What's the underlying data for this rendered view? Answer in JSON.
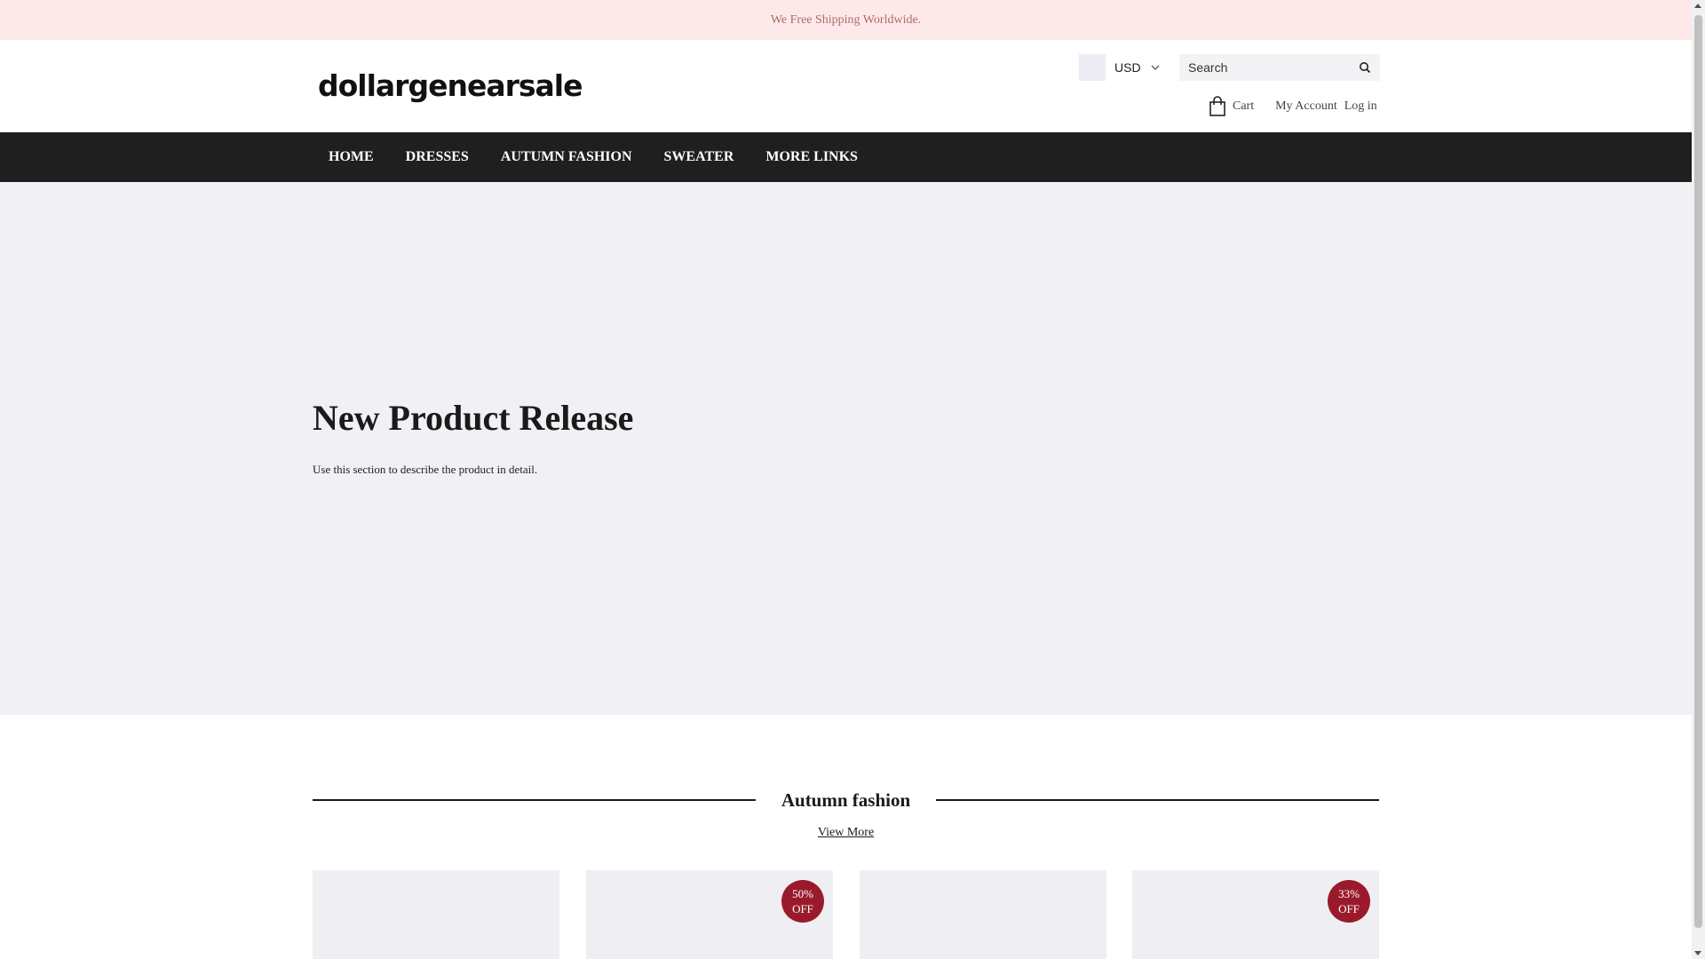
{
  "announcement": "We Free Shipping Worldwide.",
  "header": {
    "logo": "dollargenearsale",
    "currency": {
      "code": "USD"
    },
    "search": {
      "placeholder": "Search"
    },
    "cart_label": "Cart",
    "account_label": "My Account",
    "login_label": "Log in"
  },
  "nav": {
    "items": [
      {
        "label": "HOME"
      },
      {
        "label": "DRESSES"
      },
      {
        "label": "AUTUMN FASHION"
      },
      {
        "label": "SWEATER"
      },
      {
        "label": "MORE LINKS"
      }
    ]
  },
  "hero": {
    "title": "New Product Release",
    "text": "Use this section to describe the product in detail."
  },
  "section": {
    "title": "Autumn fashion",
    "view_more": "View More"
  },
  "products": [
    {
      "badge_pct": "",
      "badge_off": ""
    },
    {
      "badge_pct": "50%",
      "badge_off": "OFF"
    },
    {
      "badge_pct": "",
      "badge_off": ""
    },
    {
      "badge_pct": "33%",
      "badge_off": "OFF"
    }
  ],
  "colors": {
    "announcement_bg": "#fde9e9",
    "nav_bg": "#1f1f1f",
    "hero_bg": "#f1f1f5",
    "badge_bg": "#9a1a2b"
  }
}
